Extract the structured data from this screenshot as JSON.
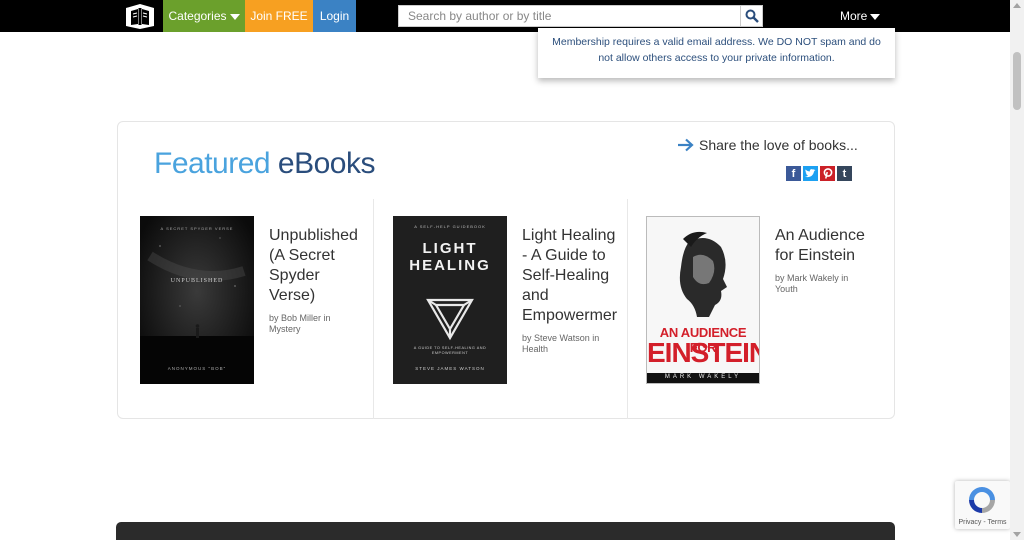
{
  "nav": {
    "categories_label": "Categories",
    "join_label": "Join FREE",
    "login_label": "Login",
    "search_placeholder": "Search by author or by title",
    "more_label": "More"
  },
  "membership_notice": {
    "line1": "Membership requires a valid email address. We DO NOT spam and do",
    "line2": "not allow others access to your private information."
  },
  "featured": {
    "title_part1": "Featured",
    "title_part2": "eBooks",
    "share_text": "Share the love of books...",
    "social_icons": [
      "facebook-icon",
      "twitter-icon",
      "pinterest-icon",
      "tumblr-icon"
    ],
    "books": [
      {
        "title_lines": [
          "Unpublished",
          "(A Secret",
          "Spyder",
          "Verse)"
        ],
        "by": "by",
        "author": "Bob Miller",
        "in": "in",
        "category": "Mystery",
        "cover": {
          "top_text": "A SECRET SPYDER VERSE",
          "main_text": "UNPUBLISHED",
          "author_text": "ANONYMOUS \"BOB\""
        }
      },
      {
        "title_lines": [
          "Light Healing",
          "- A Guide to",
          "Self-Healing",
          "and",
          "Empowermer"
        ],
        "by": "by",
        "author": "Steve Watson",
        "in": "in",
        "category": "Health",
        "cover": {
          "top_text": "A SELF-HELP GUIDEBOOK",
          "main_line1": "LIGHT",
          "main_line2": "HEALING",
          "sub_text": "A GUIDE TO SELF-HEALING AND EMPOWERMENT",
          "author_text": "STEVE JAMES WATSON"
        }
      },
      {
        "title_lines": [
          "An Audience",
          "for Einstein"
        ],
        "by": "by",
        "author": "Mark Wakely",
        "in": "in",
        "category": "Youth",
        "cover": {
          "main_line1": "AN AUDIENCE FOR",
          "main_line2": "EINSTEIN",
          "author_text": "MARK WAKELY"
        }
      }
    ]
  },
  "recaptcha": {
    "label": "Privacy - Terms"
  },
  "colors": {
    "categories_bg": "#6ba02c",
    "join_bg": "#f7a021",
    "login_bg": "#3b82c4",
    "featured_accent": "#4aa3de",
    "featured_primary": "#2a4d7c",
    "facebook": "#3b5998",
    "twitter": "#1da1f2",
    "pinterest": "#cb2027",
    "tumblr": "#35465c"
  }
}
